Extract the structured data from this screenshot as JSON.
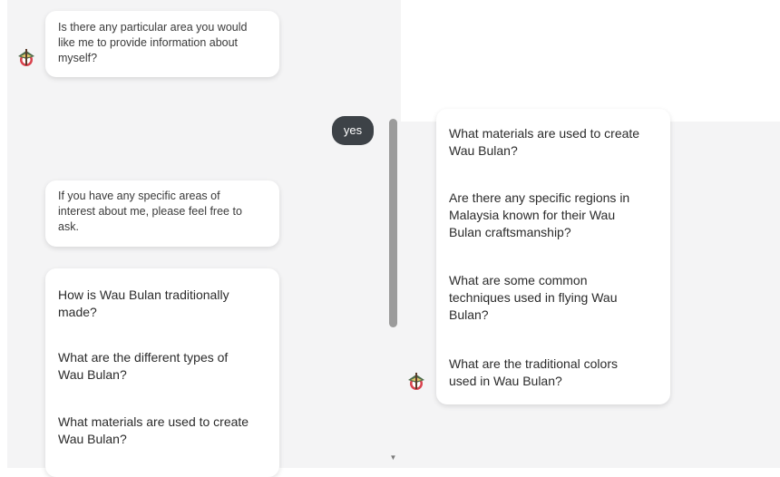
{
  "colors": {
    "panel_bg": "#f4f4f5",
    "bubble_bg": "#ffffff",
    "user_bubble_bg": "#3d4247"
  },
  "left": {
    "bot_messages": [
      {
        "lines": [
          "Is there any particular area you would",
          "like me to provide information about",
          "myself?"
        ]
      },
      {
        "lines": [
          "If you have any specific areas of",
          "interest about me, please feel free to",
          "ask."
        ]
      }
    ],
    "user_message": "yes",
    "suggestions": [
      {
        "lines": [
          "How is Wau Bulan traditionally",
          "made?"
        ]
      },
      {
        "lines": [
          "What are the different types of",
          "Wau Bulan?"
        ]
      },
      {
        "lines": [
          "What materials are used to create",
          "Wau Bulan?"
        ]
      }
    ]
  },
  "right": {
    "suggestions": [
      {
        "lines": [
          "What materials are used to create",
          "Wau Bulan?"
        ]
      },
      {
        "lines": [
          "Are there any specific regions in",
          "Malaysia known for their Wau",
          "Bulan craftsmanship?"
        ]
      },
      {
        "lines": [
          "What are some common",
          "techniques used in flying Wau",
          "Bulan?"
        ]
      },
      {
        "lines": [
          "What are the traditional colors",
          "used in Wau Bulan?"
        ]
      }
    ]
  },
  "icons": {
    "avatar": "wau-kite-avatar-icon",
    "scroll_down": "scroll-down-arrow-icon"
  }
}
